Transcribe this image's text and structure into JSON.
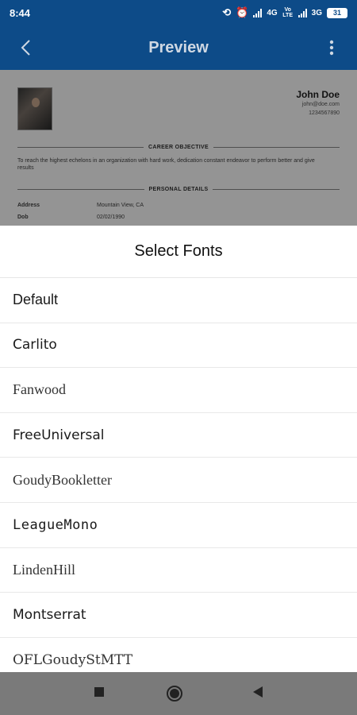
{
  "status_bar": {
    "time": "8:44",
    "network_1": "4G",
    "network_2": "3G",
    "volte": "Vo LTE",
    "battery": "31"
  },
  "app_bar": {
    "title": "Preview"
  },
  "resume": {
    "name": "John Doe",
    "email": "john@doe.com",
    "phone": "1234567890",
    "career_objective_title": "CAREER OBJECTIVE",
    "career_objective_text": "To reach the highest echelons in an organization with hard work, dedication constant endeavor to perform better and give results",
    "personal_details_title": "PERSONAL DETAILS",
    "details": [
      {
        "key": "Address",
        "value": "Mountain View, CA"
      },
      {
        "key": "Dob",
        "value": "02/02/1990"
      }
    ]
  },
  "sheet": {
    "title": "Select Fonts",
    "fonts": [
      "Default",
      "Carlito",
      "Fanwood",
      "FreeUniversal",
      "GoudyBookletter",
      "LeagueMono",
      "LindenHill",
      "Montserrat",
      "OFLGoudyStMTT"
    ]
  },
  "colors": {
    "primary": "#0d4b88",
    "nav_bar": "#7a7a7a"
  }
}
